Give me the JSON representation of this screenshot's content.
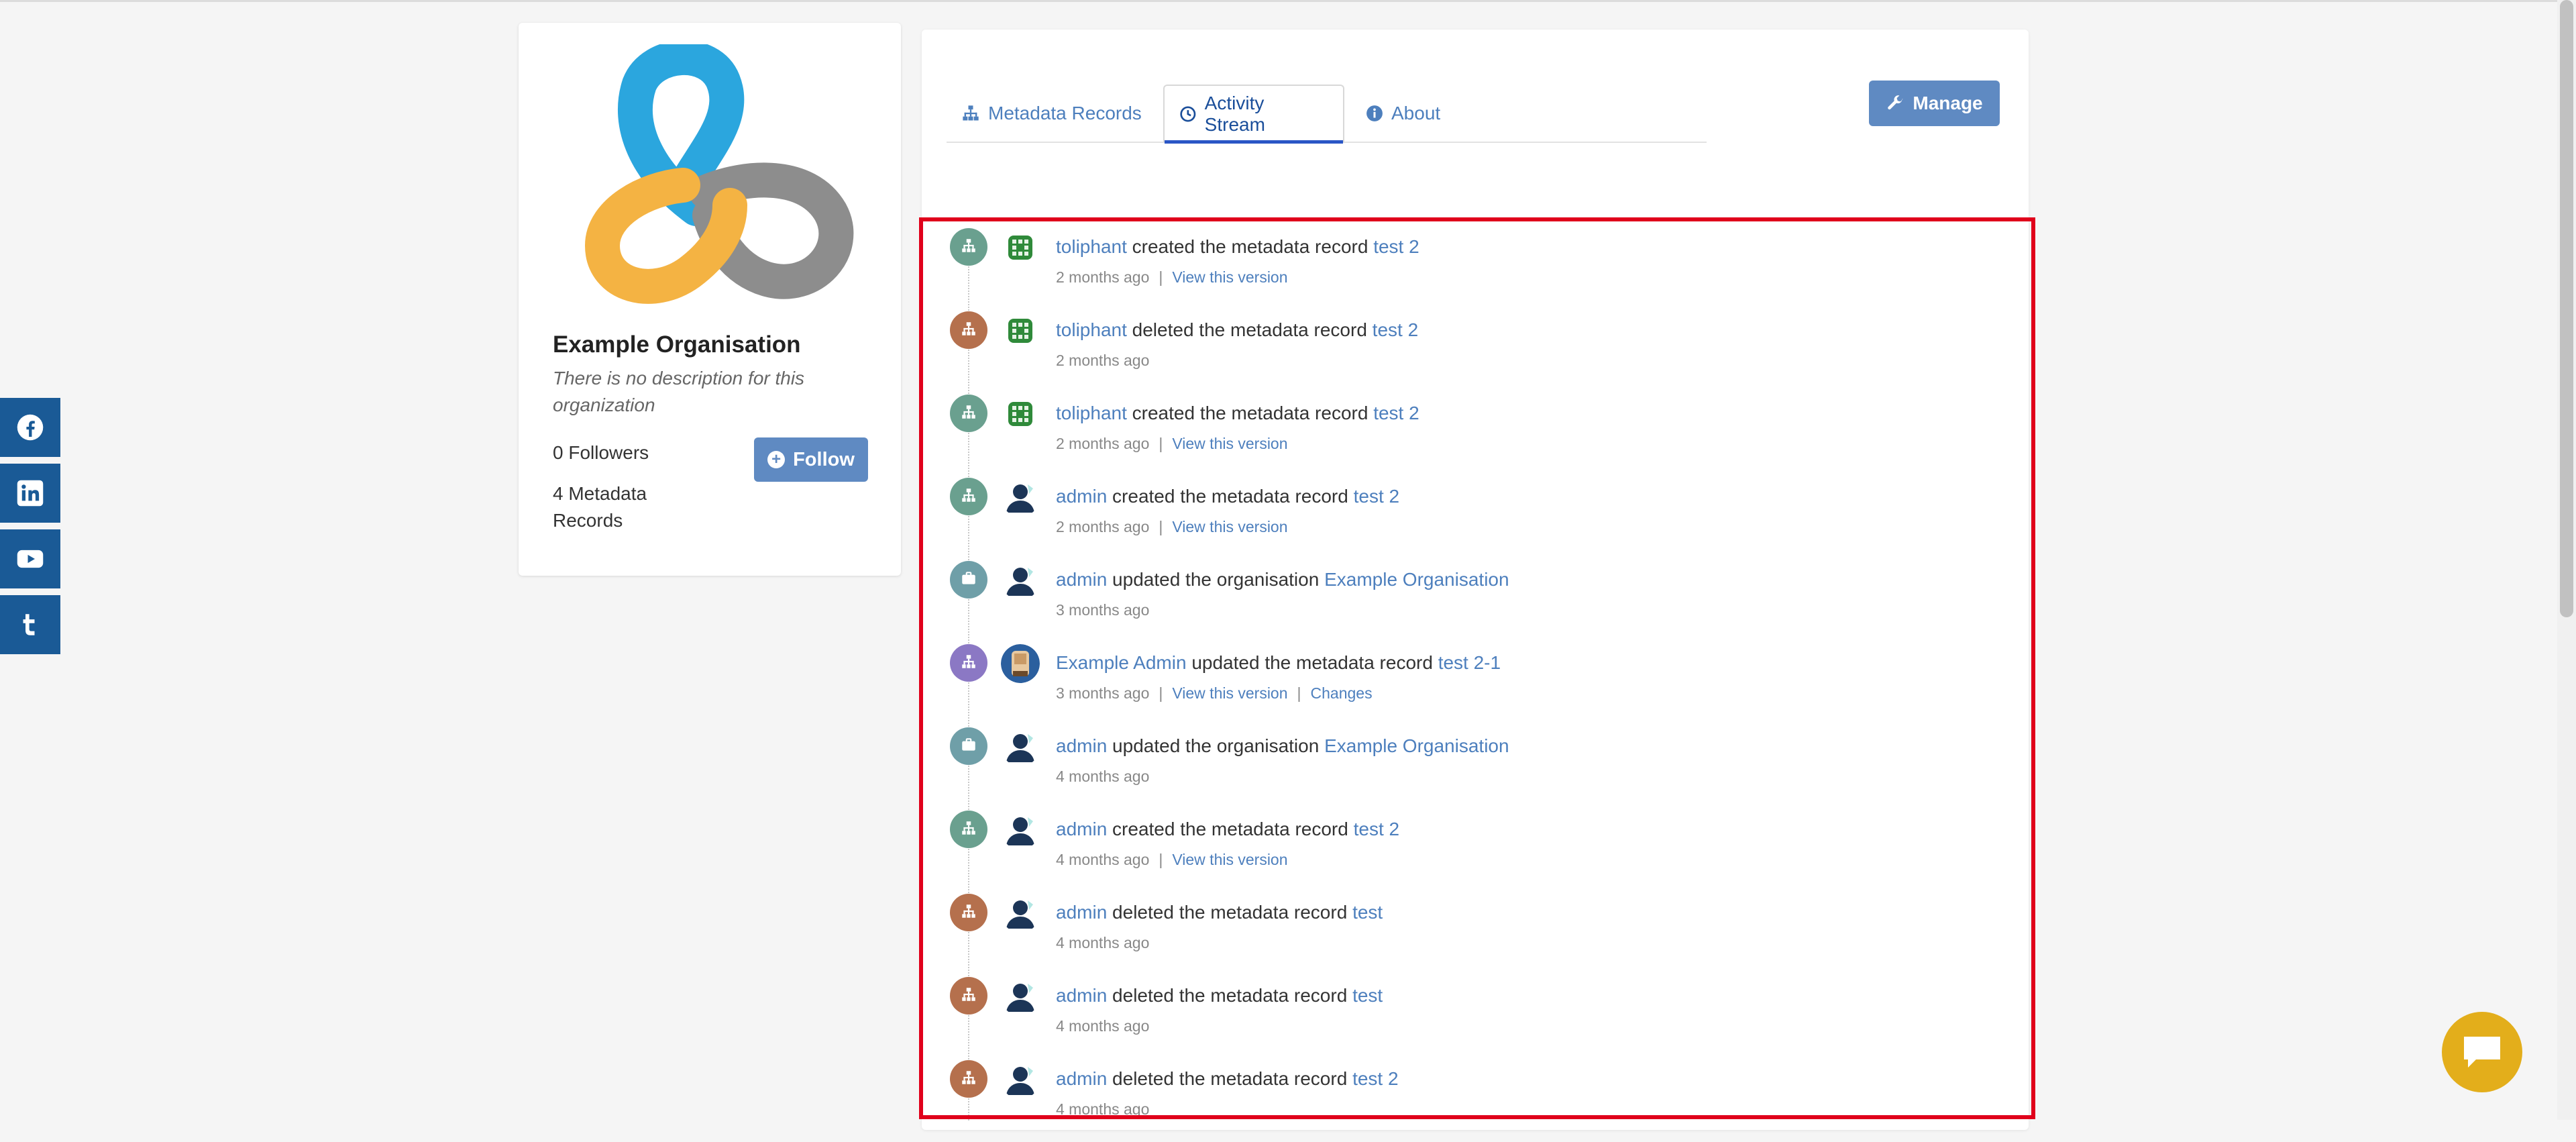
{
  "social": {
    "items": [
      {
        "name": "facebook-icon"
      },
      {
        "name": "linkedin-icon"
      },
      {
        "name": "youtube-icon"
      },
      {
        "name": "tumblr-icon"
      }
    ],
    "color": "#1a5a96"
  },
  "organization": {
    "name": "Example Organisation",
    "description": "There is no description for this organization",
    "followers": "0 Followers",
    "records": "4 Metadata Records",
    "follow_label": "Follow"
  },
  "tabs": [
    {
      "label": "Metadata Records",
      "icon": "sitemap-icon",
      "active": false
    },
    {
      "label": "Activity Stream",
      "icon": "clock-icon",
      "active": true
    },
    {
      "label": "About",
      "icon": "info-icon",
      "active": false
    }
  ],
  "manage_label": "Manage",
  "activity": [
    {
      "type": "created",
      "user": "toliphant",
      "avatar": "green",
      "action": "created the metadata record",
      "target": "test 2",
      "time": "2 months ago",
      "links": [
        "View this version"
      ]
    },
    {
      "type": "deleted",
      "user": "toliphant",
      "avatar": "green",
      "action": "deleted the metadata record",
      "target": "test 2",
      "time": "2 months ago",
      "links": []
    },
    {
      "type": "created",
      "user": "toliphant",
      "avatar": "green",
      "action": "created the metadata record",
      "target": "test 2",
      "time": "2 months ago",
      "links": [
        "View this version"
      ]
    },
    {
      "type": "created",
      "user": "admin",
      "avatar": "person",
      "action": "created the metadata record",
      "target": "test 2",
      "time": "2 months ago",
      "links": [
        "View this version"
      ]
    },
    {
      "type": "org",
      "user": "admin",
      "avatar": "person",
      "action": "updated the organisation",
      "target": "Example Organisation",
      "time": "3 months ago",
      "links": []
    },
    {
      "type": "updated",
      "user": "Example Admin",
      "avatar": "photo",
      "action": "updated the metadata record",
      "target": "test 2-1",
      "time": "3 months ago",
      "links": [
        "View this version",
        "Changes"
      ]
    },
    {
      "type": "org",
      "user": "admin",
      "avatar": "person",
      "action": "updated the organisation",
      "target": "Example Organisation",
      "time": "4 months ago",
      "links": []
    },
    {
      "type": "created",
      "user": "admin",
      "avatar": "person",
      "action": "created the metadata record",
      "target": "test 2",
      "time": "4 months ago",
      "links": [
        "View this version"
      ]
    },
    {
      "type": "deleted",
      "user": "admin",
      "avatar": "person",
      "action": "deleted the metadata record",
      "target": "test",
      "time": "4 months ago",
      "links": []
    },
    {
      "type": "deleted",
      "user": "admin",
      "avatar": "person",
      "action": "deleted the metadata record",
      "target": "test",
      "time": "4 months ago",
      "links": []
    },
    {
      "type": "deleted",
      "user": "admin",
      "avatar": "person",
      "action": "deleted the metadata record",
      "target": "test 2",
      "time": "4 months ago",
      "links": []
    }
  ],
  "colors": {
    "created": "#6aa08f",
    "deleted": "#b5704d",
    "updated": "#8b78c4",
    "org": "#6f9fa8",
    "link": "#4d7fbd",
    "accent_button": "#5f8ac2",
    "chat": "#e3ae1b",
    "highlight": "#e0001b"
  }
}
